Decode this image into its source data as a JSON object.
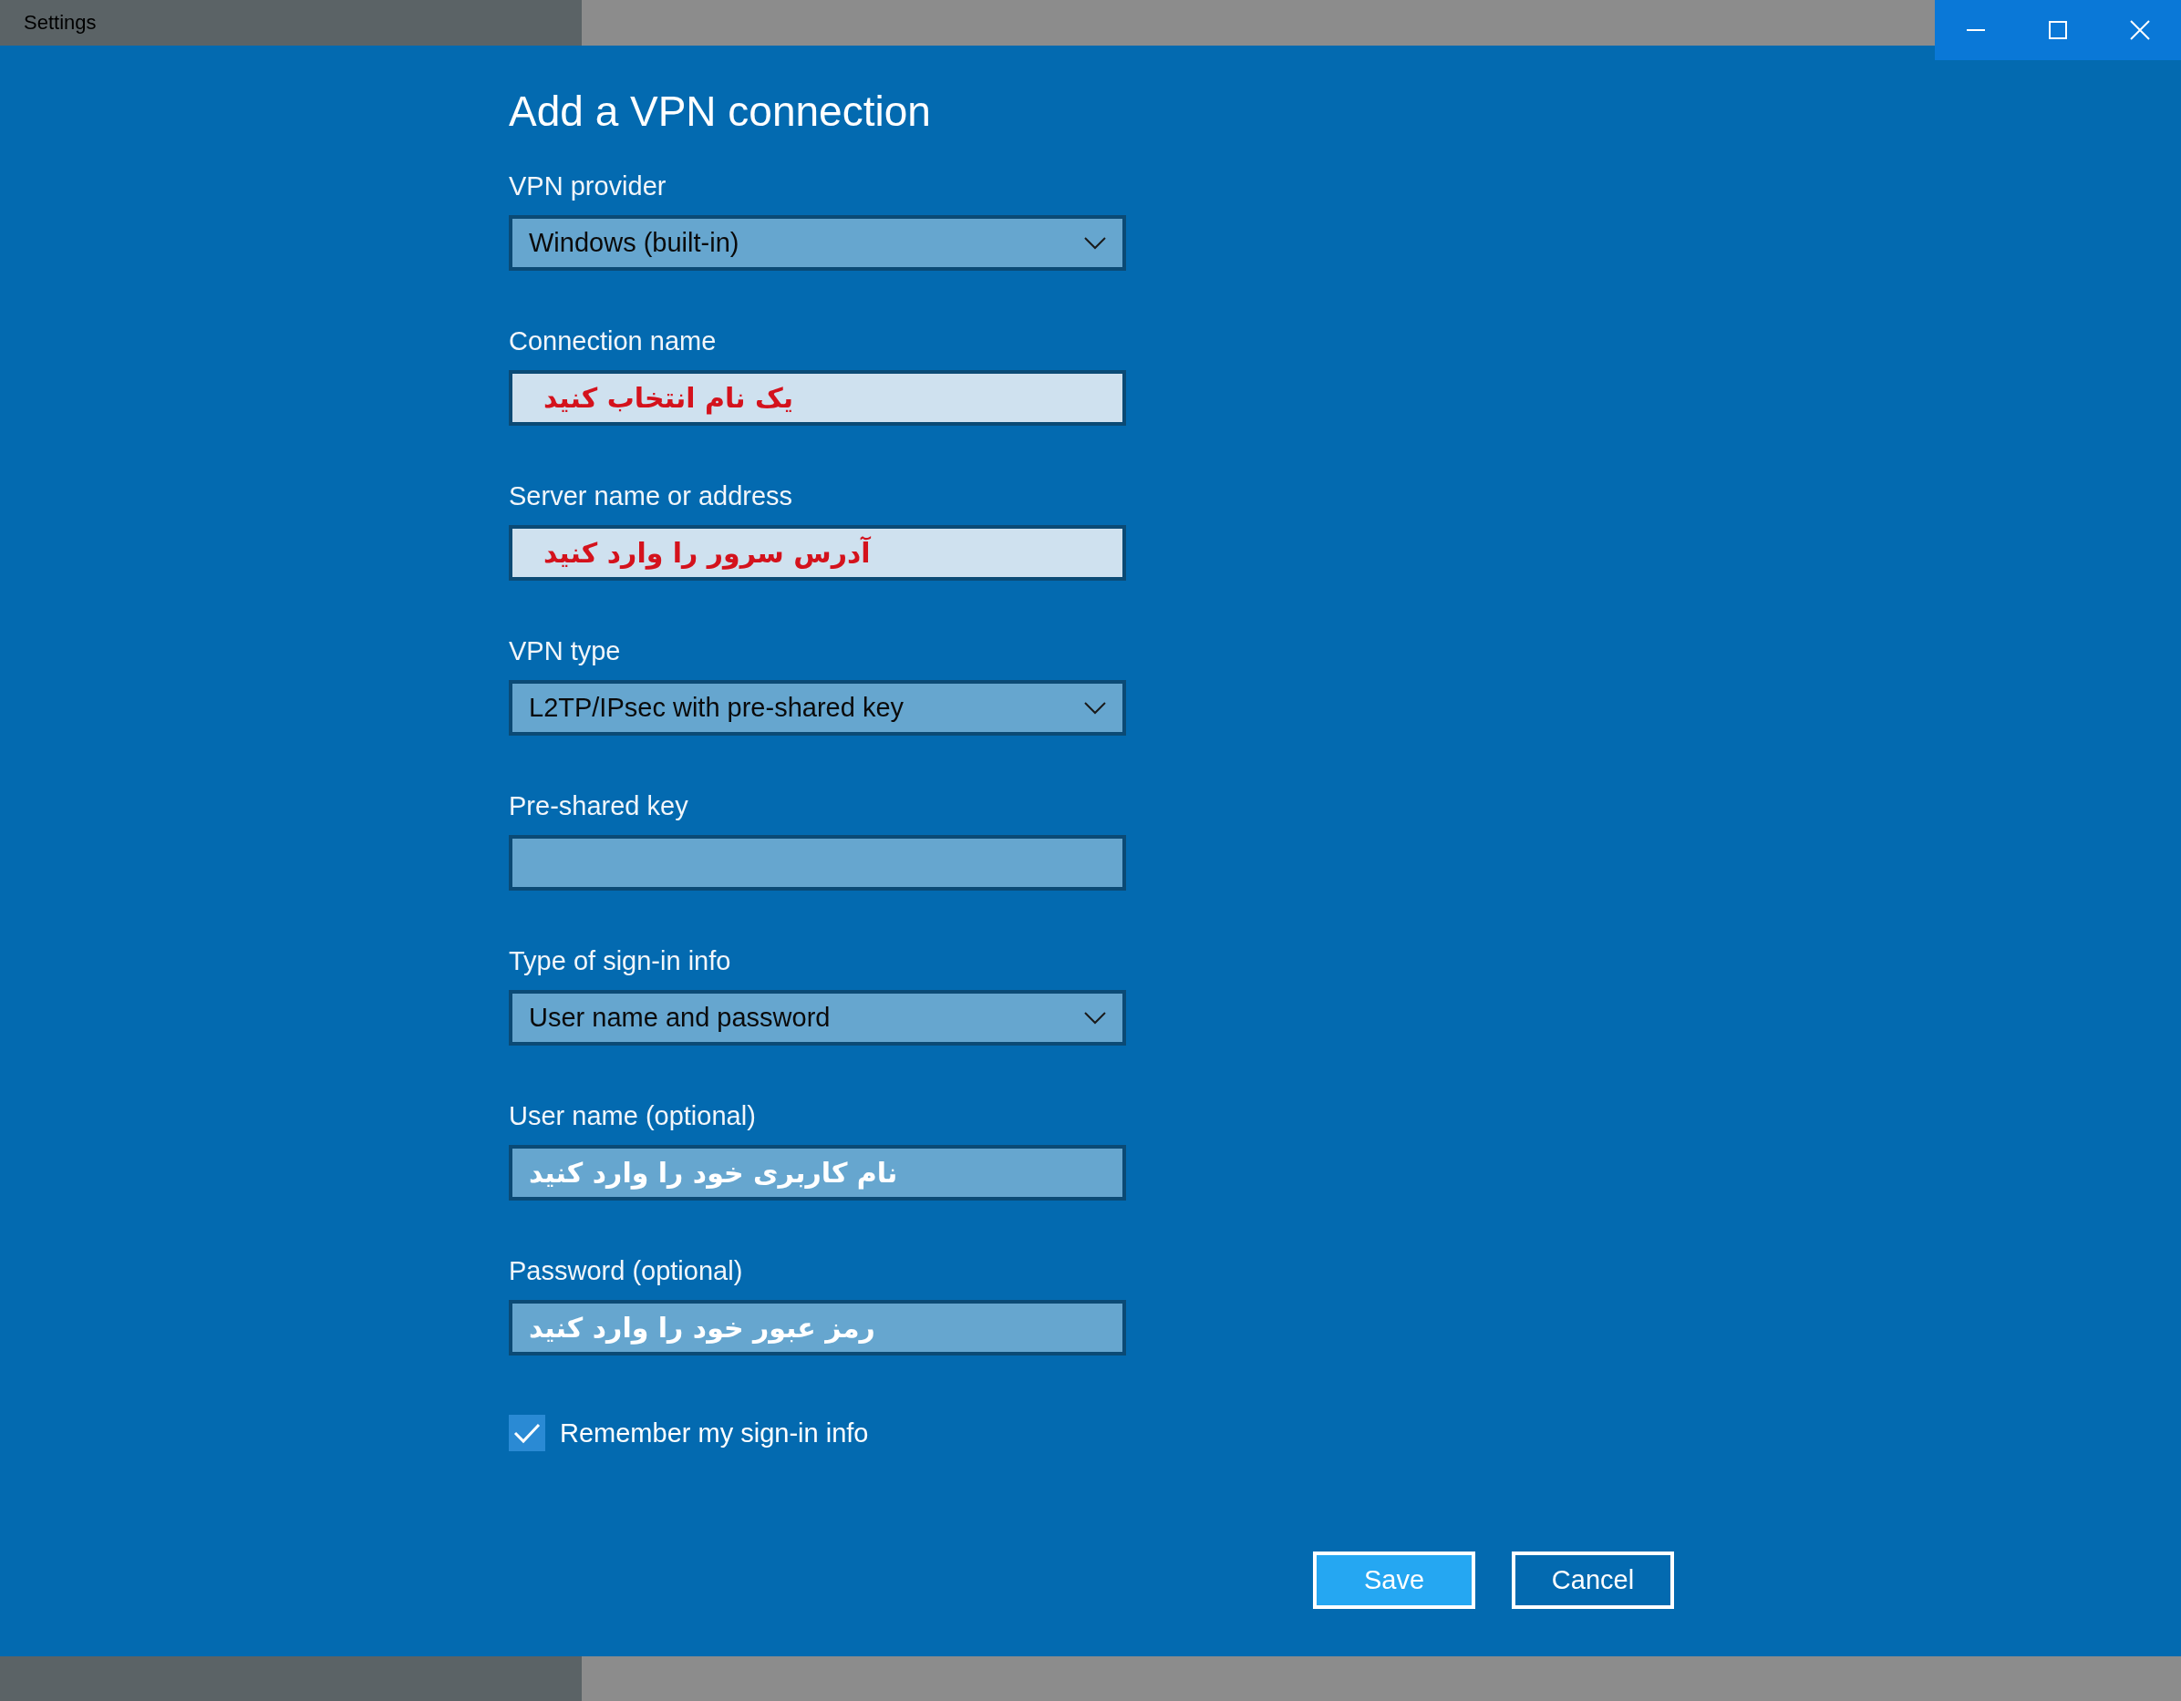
{
  "window": {
    "title": "Settings"
  },
  "heading": "Add a VPN connection",
  "fields": [
    {
      "label": "VPN provider",
      "kind": "dropdown",
      "value": "Windows (built-in)",
      "highlighted": false
    },
    {
      "label": "Connection name",
      "kind": "text",
      "value": "یک نام انتخاب کنید",
      "highlighted": true
    },
    {
      "label": "Server name or address",
      "kind": "text",
      "value": "آدرس سرور را وارد کنید",
      "highlighted": true
    },
    {
      "label": "VPN type",
      "kind": "dropdown",
      "value": "L2TP/IPsec with pre-shared key",
      "highlighted": false
    },
    {
      "label": "Pre-shared key",
      "kind": "text",
      "highlighted": false
    },
    {
      "label": "Type of sign-in info",
      "kind": "dropdown",
      "value": "User name and password",
      "highlighted": false
    },
    {
      "label": "User name (optional)",
      "kind": "text",
      "value": "نام کاربری خود را وارد کنید",
      "highlighted": false
    },
    {
      "label": "Password (optional)",
      "kind": "text",
      "value": "رمز عبور خود را وارد کنید",
      "highlighted": false
    }
  ],
  "remember": {
    "label": "Remember my sign-in info",
    "checked": true
  },
  "buttons": [
    {
      "label": "Save",
      "kind": "primary"
    },
    {
      "label": "Cancel",
      "kind": "secondary"
    }
  ]
}
